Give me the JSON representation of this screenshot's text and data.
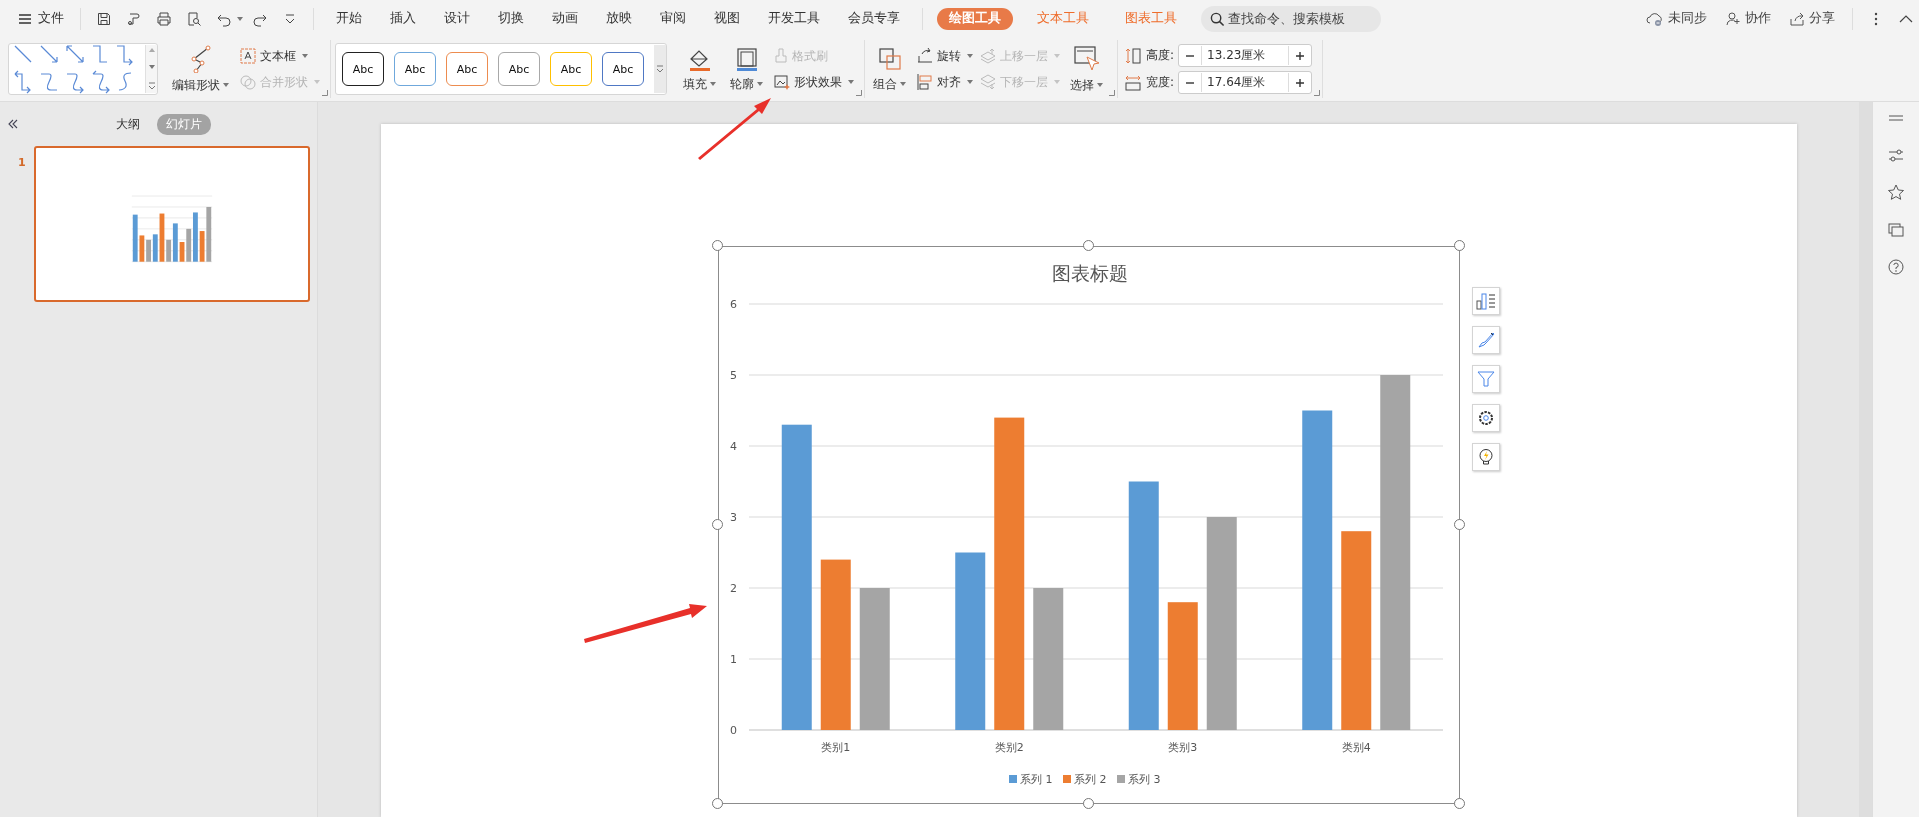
{
  "menu_bar": {
    "file_label": "文件",
    "tabs": [
      {
        "label": "开始",
        "selected": false
      },
      {
        "label": "插入",
        "selected": false
      },
      {
        "label": "设计",
        "selected": false
      },
      {
        "label": "切换",
        "selected": false
      },
      {
        "label": "动画",
        "selected": false
      },
      {
        "label": "放映",
        "selected": false
      },
      {
        "label": "审阅",
        "selected": false
      },
      {
        "label": "视图",
        "selected": false
      },
      {
        "label": "开发工具",
        "selected": false
      },
      {
        "label": "会员专享",
        "selected": false
      }
    ],
    "context_tabs": [
      {
        "label": "绘图工具",
        "selected": true
      },
      {
        "label": "文本工具",
        "selected": false
      },
      {
        "label": "图表工具",
        "selected": false
      }
    ],
    "search": {
      "placeholder": "查找命令、搜索模板"
    },
    "sync": "未同步",
    "collaborate": "协作",
    "share": "分享"
  },
  "ribbon": {
    "edit_shape": {
      "label": "编辑形状",
      "disabled": false
    },
    "text_box": {
      "label": "文本框",
      "disabled": false
    },
    "merge_shapes": {
      "label": "合并形状",
      "disabled": true
    },
    "styles": [
      {
        "label": "Abc",
        "color": "#222222"
      },
      {
        "label": "Abc",
        "color": "#6fa8dc"
      },
      {
        "label": "Abc",
        "color": "#ed8c4f"
      },
      {
        "label": "Abc",
        "color": "#a8a8a8"
      },
      {
        "label": "Abc",
        "color": "#ffc000"
      },
      {
        "label": "Abc",
        "color": "#4f78c4"
      }
    ],
    "fill": {
      "label": "填充",
      "disabled": false
    },
    "outline": {
      "label": "轮廓",
      "disabled": false
    },
    "format_painter": {
      "label": "格式刷",
      "disabled": true
    },
    "shape_effects": {
      "label": "形状效果",
      "disabled": false
    },
    "group": {
      "label": "组合",
      "disabled": false
    },
    "rotate": {
      "label": "旋转",
      "disabled": false
    },
    "align": {
      "label": "对齐",
      "disabled": false
    },
    "bring_forward": {
      "label": "上移一层",
      "disabled": true
    },
    "send_backward": {
      "label": "下移一层",
      "disabled": true
    },
    "select": {
      "label": "选择",
      "disabled": false
    },
    "height": {
      "label": "高度:",
      "value": "13.23厘米"
    },
    "width": {
      "label": "宽度:",
      "value": "17.64厘米"
    }
  },
  "left_panel": {
    "tabs": [
      {
        "label": "大纲",
        "selected": false
      },
      {
        "label": "幻灯片",
        "selected": true
      }
    ],
    "slides": [
      {
        "number": "1",
        "selected": true
      }
    ]
  },
  "chart": {
    "chart_data": {
      "type": "bar",
      "title": "图表标题",
      "categories": [
        "类别1",
        "类别2",
        "类别3",
        "类别4"
      ],
      "series": [
        {
          "name": "系列 1",
          "color": "#5b9bd5",
          "values": [
            4.3,
            2.5,
            3.5,
            4.5
          ]
        },
        {
          "name": "系列 2",
          "color": "#ed7d31",
          "values": [
            2.4,
            4.4,
            1.8,
            2.8
          ]
        },
        {
          "name": "系列 3",
          "color": "#a5a5a5",
          "values": [
            2,
            2,
            3,
            5
          ]
        }
      ],
      "ylim": [
        0,
        6
      ],
      "yticks": [
        0,
        1,
        2,
        3,
        4,
        5,
        6
      ],
      "grid": true,
      "legend": "bottom"
    }
  }
}
